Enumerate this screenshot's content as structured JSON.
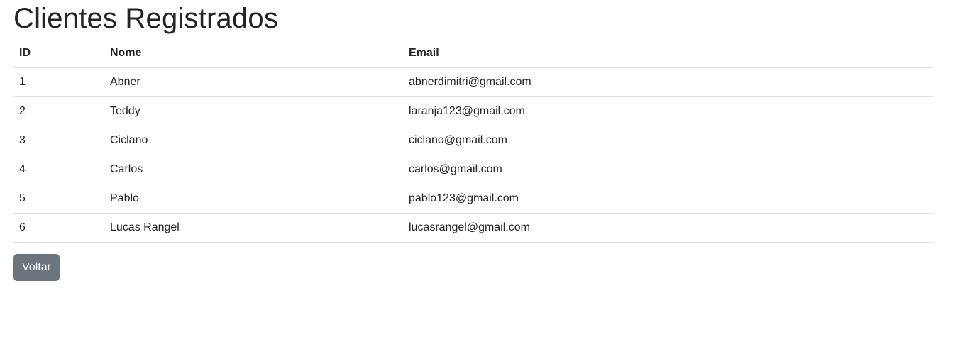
{
  "page": {
    "title": "Clientes Registrados"
  },
  "table": {
    "headers": {
      "id": "ID",
      "nome": "Nome",
      "email": "Email"
    },
    "rows": [
      {
        "id": "1",
        "nome": "Abner",
        "email": "abnerdimitri@gmail.com"
      },
      {
        "id": "2",
        "nome": "Teddy",
        "email": "laranja123@gmail.com"
      },
      {
        "id": "3",
        "nome": "Ciclano",
        "email": "ciclano@gmail.com"
      },
      {
        "id": "4",
        "nome": "Carlos",
        "email": "carlos@gmail.com"
      },
      {
        "id": "5",
        "nome": "Pablo",
        "email": "pablo123@gmail.com"
      },
      {
        "id": "6",
        "nome": "Lucas Rangel",
        "email": "lucasrangel@gmail.com"
      }
    ]
  },
  "actions": {
    "back_label": "Voltar"
  },
  "colors": {
    "text": "#212529",
    "border": "#dee2e6",
    "secondary_button": "#6c757d"
  }
}
